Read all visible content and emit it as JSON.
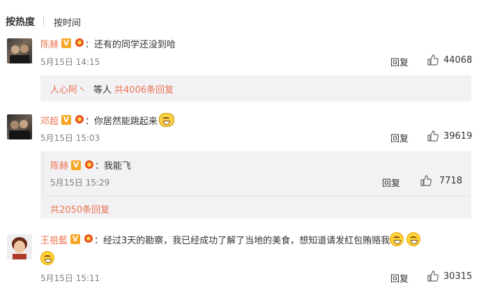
{
  "sort": {
    "hot": "按热度",
    "time": "按时间"
  },
  "actions": {
    "reply": "回复"
  },
  "comments": [
    {
      "user": "陈赫",
      "text": "：还有的同学还没到哈",
      "time": "5月15日 14:15",
      "likes": "44068",
      "preview": {
        "names": "人心阿丶",
        "etc": "等人",
        "count": "共4006条回复"
      }
    },
    {
      "user": "邓超",
      "text": "：你居然能跳起来",
      "time": "5月15日 15:03",
      "likes": "39619",
      "subreply": {
        "user": "陈赫",
        "text": "：我能飞",
        "time": "5月15日 15:29",
        "likes": "7718"
      },
      "more": "共2050条回复"
    },
    {
      "user": "王祖藍",
      "text": "：经过3天的勘察，我已经成功了解了当地的美食，想知道请发红包贿赂我",
      "time": "5月15日 15:11",
      "likes": "30315"
    }
  ],
  "badges": {
    "verified": "V"
  }
}
